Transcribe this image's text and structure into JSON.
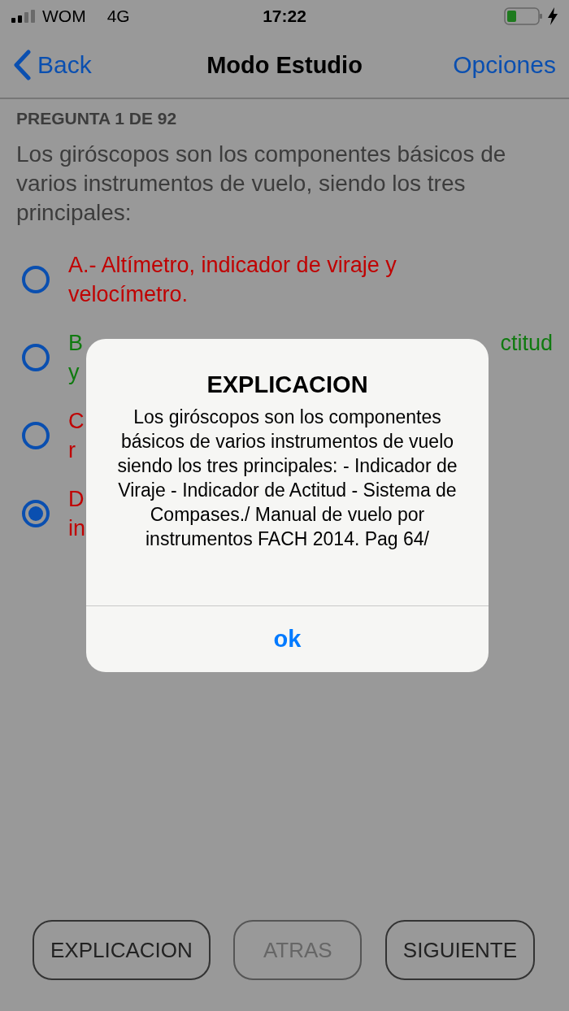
{
  "status_bar": {
    "carrier": "WOM",
    "network": "4G",
    "time": "17:22",
    "charging": true
  },
  "nav": {
    "back": "Back",
    "title": "Modo Estudio",
    "action": "Opciones"
  },
  "counter": "PREGUNTA 1 DE 92",
  "question": "Los giróscopos son los componentes básicos de varios instrumentos de vuelo, siendo los tres principales:",
  "options": [
    {
      "color": "#c00000",
      "selected": false,
      "lines": [
        {
          "left": "A.- Altímetro, indicador de viraje y"
        },
        {
          "left": "velocímetro."
        }
      ]
    },
    {
      "color": "#107a10",
      "selected": false,
      "lines": [
        {
          "left": "B",
          "right": "ctitud"
        },
        {
          "left": "y"
        }
      ]
    },
    {
      "color": "#c00000",
      "selected": false,
      "lines": [
        {
          "left": "C"
        },
        {
          "left": "r"
        }
      ]
    },
    {
      "color": "#c00000",
      "selected": true,
      "lines": [
        {
          "left": "D"
        },
        {
          "left": "in"
        }
      ]
    }
  ],
  "buttons": [
    {
      "label": "EXPLICACION",
      "disabled": false
    },
    {
      "label": "ATRAS",
      "disabled": true
    },
    {
      "label": "SIGUIENTE",
      "disabled": false
    }
  ],
  "dialog": {
    "title": "EXPLICACION",
    "message": "Los giróscopos son los componentes básicos de varios instrumentos de vuelo siendo los tres principales: - Indicador de Viraje - Indicador de Actitud - Sistema de Compases./ Manual de vuelo por instrumentos FACH 2014. Pag 64/",
    "button": "ok"
  }
}
